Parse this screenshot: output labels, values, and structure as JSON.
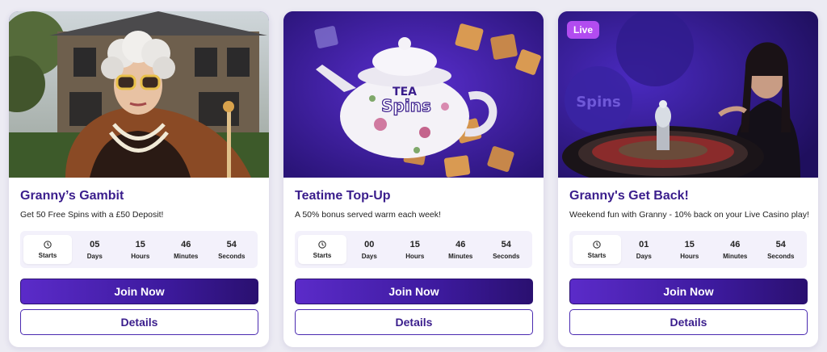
{
  "cards": [
    {
      "title": "Granny’s Gambit",
      "description": "Get 50 Free Spins with a £50 Deposit!",
      "badge": "",
      "timer": {
        "starts_label": "Starts",
        "days": "05",
        "hours": "15",
        "minutes": "46",
        "seconds": "54",
        "days_label": "Days",
        "hours_label": "Hours",
        "minutes_label": "Minutes",
        "seconds_label": "Seconds"
      },
      "join_label": "Join Now",
      "details_label": "Details"
    },
    {
      "title": "Teatime Top-Up",
      "description": "A 50% bonus served warm each week!",
      "badge": "",
      "timer": {
        "starts_label": "Starts",
        "days": "00",
        "hours": "15",
        "minutes": "46",
        "seconds": "54",
        "days_label": "Days",
        "hours_label": "Hours",
        "minutes_label": "Minutes",
        "seconds_label": "Seconds"
      },
      "join_label": "Join Now",
      "details_label": "Details"
    },
    {
      "title": "Granny's Get Back!",
      "description": "Weekend fun with Granny - 10% back on your Live Casino play!",
      "badge": "Live",
      "timer": {
        "starts_label": "Starts",
        "days": "01",
        "hours": "15",
        "minutes": "46",
        "seconds": "54",
        "days_label": "Days",
        "hours_label": "Hours",
        "minutes_label": "Minutes",
        "seconds_label": "Seconds"
      },
      "join_label": "Join Now",
      "details_label": "Details"
    }
  ],
  "logo_text": [
    "TEA",
    "Spins"
  ],
  "icons": {
    "clock": "clock-icon"
  },
  "colors": {
    "accent": "#3a1d8c",
    "button_gradient_start": "#5b2bc9",
    "button_gradient_end": "#2a1070",
    "live_badge": "#b24cf0",
    "timer_bg": "#f3f1fb"
  }
}
